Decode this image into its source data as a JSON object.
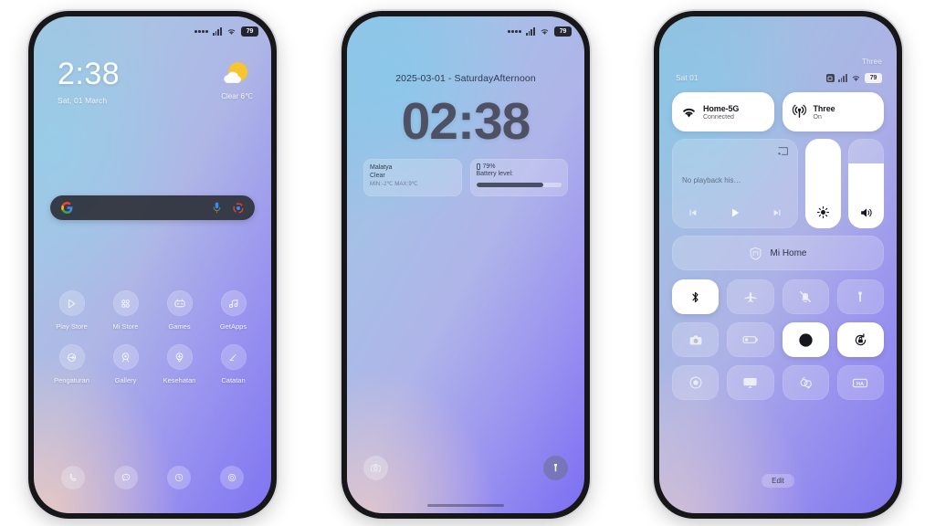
{
  "page": {
    "background": "#ffffff",
    "accent": "#7f74f2"
  },
  "phones": {
    "home": {
      "status": {
        "battery": "79",
        "icons": [
          "dots-icon",
          "signal-bars-icon",
          "wifi-icon",
          "battery-badge"
        ]
      },
      "clock": {
        "time": "2:38",
        "date": "Sat, 01 March"
      },
      "weather": {
        "icon": "sun-behind-cloud-icon",
        "text": "Clear 6℃"
      },
      "search": {
        "logo": "google-logo",
        "placeholder": "",
        "value": "",
        "mic": "mic-icon",
        "lens": "google-lens-icon"
      },
      "apps": [
        {
          "label": "Play Store",
          "icon": "play-store-icon"
        },
        {
          "label": "Mi Store",
          "icon": "mi-store-icon"
        },
        {
          "label": "Games",
          "icon": "games-controller-icon"
        },
        {
          "label": "GetApps",
          "icon": "getapps-icon"
        },
        {
          "label": "Pengaturan",
          "icon": "settings-icon"
        },
        {
          "label": "Gallery",
          "icon": "gallery-icon"
        },
        {
          "label": "Kesehatan",
          "icon": "health-icon"
        },
        {
          "label": "Catatan",
          "icon": "notes-icon"
        }
      ],
      "dock": [
        {
          "name": "phone-icon"
        },
        {
          "name": "messages-icon"
        },
        {
          "name": "clock-icon"
        },
        {
          "name": "camera-icon"
        }
      ]
    },
    "lock": {
      "status": {
        "battery": "79"
      },
      "date_line": "2025-03-01 - SaturdayAfternoon",
      "time": "02:38",
      "weather_widget": {
        "city": "Malatya",
        "condition": "Clear",
        "range": "MIN:-2℃  MAX:9℃"
      },
      "battery_widget": {
        "percent": "79%",
        "label": "Battery level:",
        "fill_percent": 79
      },
      "actions": [
        {
          "name": "camera-shortcut",
          "icon": "camera-icon"
        },
        {
          "name": "flashlight-shortcut",
          "icon": "flashlight-icon"
        }
      ]
    },
    "control_center": {
      "carrier": "Three",
      "date": "Sat 01",
      "status": {
        "battery": "79"
      },
      "connectivity": [
        {
          "icon": "wifi-icon",
          "title": "Home-5G",
          "subtitle": "Connected"
        },
        {
          "icon": "cellular-icon",
          "title": "Three",
          "subtitle": "On"
        }
      ],
      "media": {
        "title": "No playback his…",
        "cast": "cast-icon",
        "controls": [
          "previous-icon",
          "play-icon",
          "next-icon"
        ]
      },
      "sliders": [
        {
          "name": "brightness-slider",
          "icon": "brightness-icon",
          "value": 100
        },
        {
          "name": "volume-slider",
          "icon": "volume-icon",
          "value": 72
        }
      ],
      "mi_home": {
        "label": "Mi Home",
        "icon": "mi-home-icon"
      },
      "toggles": [
        {
          "name": "bluetooth-toggle",
          "icon": "bluetooth-icon",
          "on": true
        },
        {
          "name": "airplane-mode-toggle",
          "icon": "airplane-icon",
          "on": false
        },
        {
          "name": "silent-mode-toggle",
          "icon": "bell-muted-icon",
          "on": false
        },
        {
          "name": "flashlight-toggle",
          "icon": "flashlight-icon",
          "on": false
        },
        {
          "name": "camera-toggle",
          "icon": "camera-icon",
          "on": false
        },
        {
          "name": "battery-saver-toggle",
          "icon": "battery-low-icon",
          "on": false
        },
        {
          "name": "dark-mode-toggle",
          "icon": "contrast-icon",
          "on": true
        },
        {
          "name": "rotation-lock-toggle",
          "icon": "rotation-lock-icon",
          "on": true
        },
        {
          "name": "screen-record-toggle",
          "icon": "record-icon",
          "on": false
        },
        {
          "name": "cast-screen-toggle",
          "icon": "screencast-icon",
          "on": false
        },
        {
          "name": "sync-toggle",
          "icon": "sync-icon",
          "on": false
        },
        {
          "name": "hd-audio-toggle",
          "icon": "hd-icon",
          "on": false
        }
      ],
      "edit_label": "Edit"
    }
  }
}
